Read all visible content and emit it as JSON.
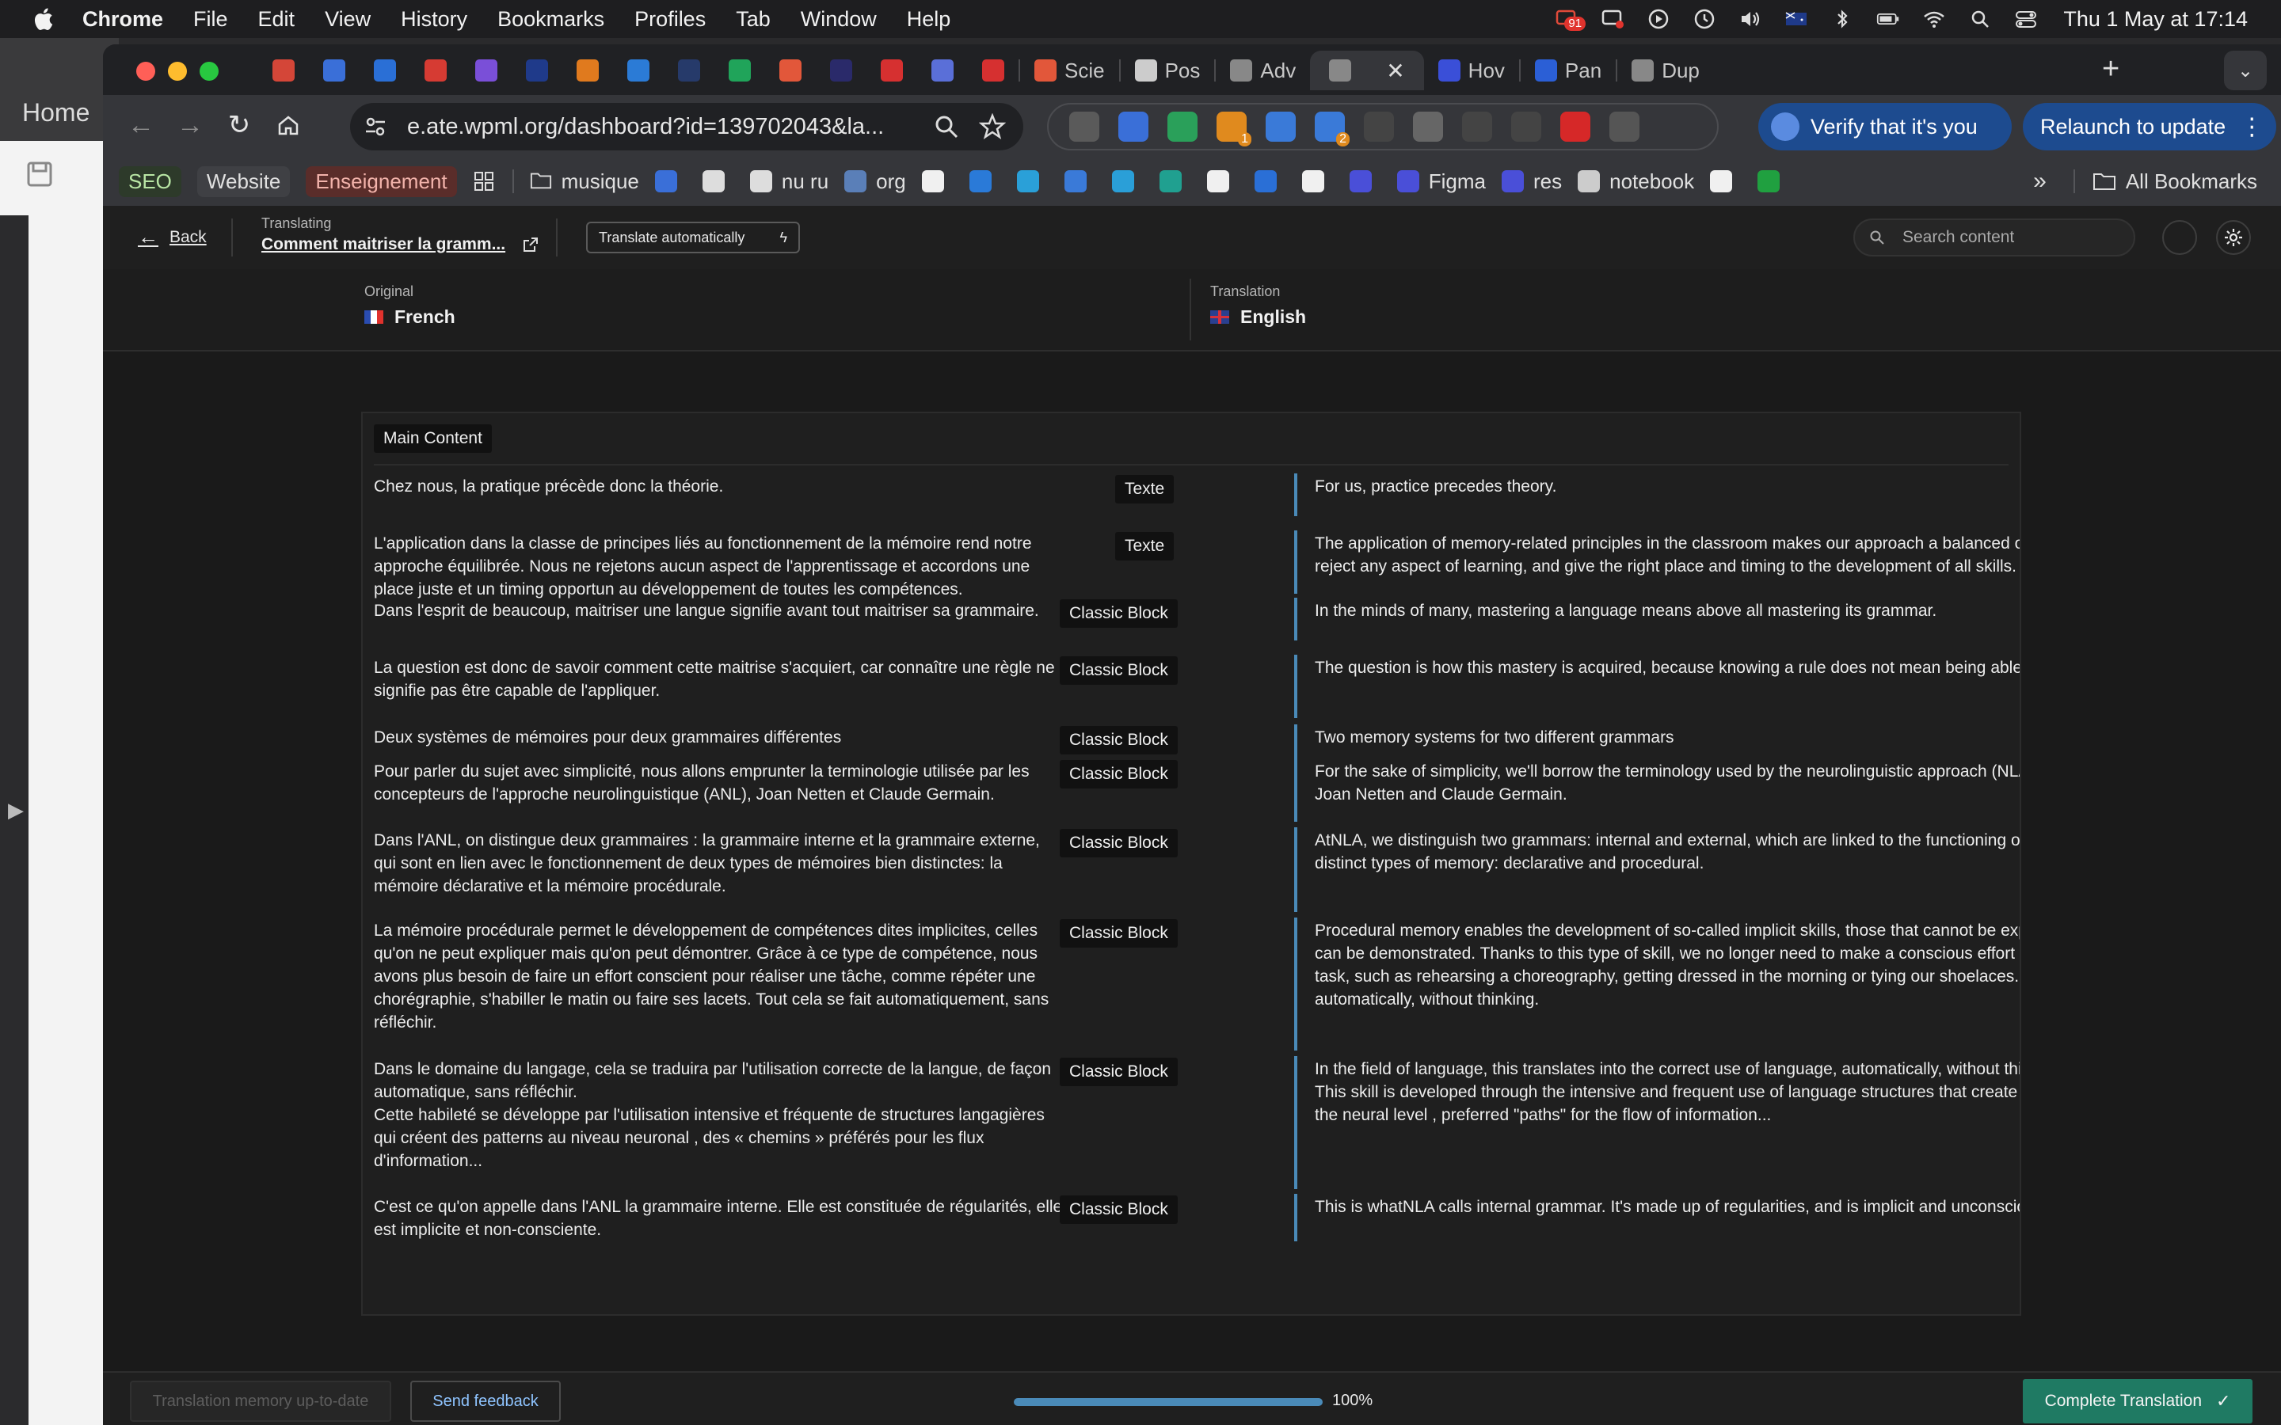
{
  "menubar": {
    "app": "Chrome",
    "items": [
      "File",
      "Edit",
      "View",
      "History",
      "Bookmarks",
      "Profiles",
      "Tab",
      "Window",
      "Help"
    ],
    "notification_count": "91",
    "clock": "Thu 1 May at  17:14"
  },
  "background_window": {
    "home": "Home"
  },
  "tabs": [
    {
      "title": "",
      "color": "#d44638"
    },
    {
      "title": "",
      "color": "#3a6fd8"
    },
    {
      "title": "",
      "color": "#2a6fd6"
    },
    {
      "title": "",
      "color": "#d63b33"
    },
    {
      "title": "",
      "color": "#7a4fd8"
    },
    {
      "title": "",
      "color": "#1f3a8a"
    },
    {
      "title": "",
      "color": "#e07a1e"
    },
    {
      "title": "",
      "color": "#2b7bd6"
    },
    {
      "title": "",
      "color": "#263a6a"
    },
    {
      "title": "",
      "color": "#20a45a"
    },
    {
      "title": "",
      "color": "#e2573a"
    },
    {
      "title": "",
      "color": "#2a2a6a"
    },
    {
      "title": "",
      "color": "#d63030"
    },
    {
      "title": "",
      "color": "#5a6fd8"
    },
    {
      "title": "",
      "color": "#d63030"
    },
    {
      "title": "Scie",
      "color": "#e2573a"
    },
    {
      "title": "Pos",
      "color": "#cccccc"
    },
    {
      "title": "Adv",
      "color": "#888888"
    },
    {
      "title": "",
      "color": "#888888",
      "active": true
    },
    {
      "title": "Hov",
      "color": "#3a4fd8"
    },
    {
      "title": "Pan",
      "color": "#2b5fd6"
    },
    {
      "title": "Dup",
      "color": "#888888"
    }
  ],
  "address_bar": {
    "url": "e.ate.wpml.org/dashboard?id=139702043&la..."
  },
  "extensions": [
    {
      "color": "#5a5a5a"
    },
    {
      "color": "#3a6fd8"
    },
    {
      "color": "#2aa05a"
    },
    {
      "color": "#e08a1e",
      "count": "1"
    },
    {
      "color": "#3a7ad8"
    },
    {
      "color": "#3a7ad8",
      "count": "2"
    },
    {
      "color": "#444444"
    },
    {
      "color": "#666666"
    },
    {
      "color": "#444444"
    },
    {
      "color": "#444444"
    },
    {
      "color": "#d62828"
    },
    {
      "color": "#555555"
    }
  ],
  "profile_buttons": {
    "verify": "Verify that it's you",
    "relaunch": "Relaunch to update"
  },
  "bookmarks": {
    "pills": [
      "SEO",
      "Website",
      "Enseignement"
    ],
    "items": [
      {
        "label": "musique",
        "color": "#00000000",
        "folder": true
      },
      {
        "label": "",
        "color": "#3a6fd8"
      },
      {
        "label": "",
        "color": "#dddddd"
      },
      {
        "label": "nu ru",
        "color": "#dddddd"
      },
      {
        "label": "org",
        "color": "#5a7fb8"
      },
      {
        "label": "",
        "color": "#f0f0f0"
      },
      {
        "label": "",
        "color": "#2a7ad8"
      },
      {
        "label": "",
        "color": "#2aa0d8"
      },
      {
        "label": "",
        "color": "#3a7ad8"
      },
      {
        "label": "",
        "color": "#2a9fd8"
      },
      {
        "label": "",
        "color": "#20a090"
      },
      {
        "label": "",
        "color": "#f0f0f0"
      },
      {
        "label": "",
        "color": "#2a6fd6"
      },
      {
        "label": "",
        "color": "#f0f0f0"
      },
      {
        "label": "",
        "color": "#4a4fd8"
      },
      {
        "label": "Figma",
        "color": "#4a4fd8"
      },
      {
        "label": "res",
        "color": "#4a4fd8"
      },
      {
        "label": "notebook",
        "color": "#cccccc"
      },
      {
        "label": "",
        "color": "#f0f0f0"
      },
      {
        "label": "",
        "color": "#20a040"
      }
    ],
    "all_bookmarks": "All Bookmarks"
  },
  "header": {
    "back": "Back",
    "translating_label": "Translating",
    "translating_title": "Comment maitriser la gramm...",
    "translate_auto": "Translate automatically",
    "search_placeholder": "Search content"
  },
  "languages": {
    "original_label": "Original",
    "original": "French",
    "translation_label": "Translation",
    "translation": "English"
  },
  "main_content_label": "Main Content",
  "segments": [
    {
      "type": "Texte",
      "original": "Chez nous, la pratique précède donc la théorie.",
      "translation": "For us, practice precedes theory."
    },
    {
      "type": "Texte",
      "original": "L'application dans la classe de principes liés au fonctionnement de la mémoire rend notre approche équilibrée. Nous ne rejetons aucun aspect de l'apprentissage et accordons une place juste et un timing opportun au développement de toutes les compétences.",
      "translation": "The application of memory-related principles in the classroom makes our approach a balanced one. We don't reject any aspect of learning, and give the right place and timing to the development of all skills."
    },
    {
      "type": "Classic Block",
      "original": "Dans l'esprit de beaucoup, maitriser une langue signifie avant tout maitriser sa grammaire.",
      "translation": "In the minds of many, mastering a language means above all mastering its grammar."
    },
    {
      "type": "Classic Block",
      "original": "La question est donc de savoir comment cette maitrise s'acquiert, car connaître une règle ne signifie pas être capable de l'appliquer.",
      "translation": "The question is how this mastery is acquired, because knowing a rule does not mean being able to apply it."
    },
    {
      "type": "Classic Block",
      "original": "Deux systèmes de mémoires pour deux grammaires différentes",
      "translation": "Two memory systems for two different grammars"
    },
    {
      "type": "Classic Block",
      "original": "Pour parler du sujet avec simplicité, nous allons emprunter la terminologie utilisée par les concepteurs de l'approche neurolinguistique (ANL), Joan Netten et Claude Germain.",
      "translation": "For the sake of simplicity, we'll borrow the terminology used by the neurolinguistic approach (NLA) designers Joan Netten and Claude Germain."
    },
    {
      "type": "Classic Block",
      "original": "Dans l'ANL, on distingue deux grammaires : la grammaire interne et la grammaire externe, qui sont en lien avec le fonctionnement de deux types de mémoires bien distinctes: la mémoire déclarative et la mémoire procédurale.",
      "translation": "AtNLA, we distinguish two grammars: internal and external, which are linked to the functioning of two very distinct types of memory: declarative and procedural."
    },
    {
      "type": "Classic Block",
      "original": "La mémoire procédurale permet le développement de compétences dites implicites, celles qu'on ne peut expliquer mais qu'on peut démontrer. Grâce à ce type de compétence, nous avons plus besoin de faire un effort conscient pour réaliser une tâche, comme répéter une chorégraphie, s'habiller le matin ou faire ses lacets. Tout cela se fait automatiquement, sans réfléchir.",
      "translation": "Procedural memory enables the development of so-called implicit skills, those that cannot be explained but can be demonstrated. Thanks to this type of skill, we no longer need to make a conscious effort to perform a task, such as rehearsing a choreography, getting dressed in the morning or tying our shoelaces. It's all done automatically, without thinking."
    },
    {
      "type": "Classic Block",
      "original": "Dans le domaine du langage, cela se traduira par l'utilisation correcte de la langue, de façon automatique, sans réfléchir.\nCette habileté se développe par l'utilisation intensive et fréquente de structures langagières qui créent des patterns au niveau neuronal , des « chemins » préférés pour les flux d'information...",
      "translation": "In the field of language, this translates into the correct use of language, automatically, without thinking.\nThis skill is developed through the intensive and frequent use of language structures that create patterns at the neural level , preferred \"paths\" for the flow of information..."
    },
    {
      "type": "Classic Block",
      "original": "C'est ce qu'on appelle dans l'ANL la grammaire interne. Elle est constituée de régularités, elle est implicite et non-consciente.",
      "translation": "This is whatNLA calls internal grammar. It's made up of regularities, and is implicit and unconscious."
    }
  ],
  "footer": {
    "tm_status": "Translation memory up-to-date",
    "feedback": "Send feedback",
    "progress_percent": 100,
    "progress_label": "100%",
    "complete": "Complete Translation"
  }
}
